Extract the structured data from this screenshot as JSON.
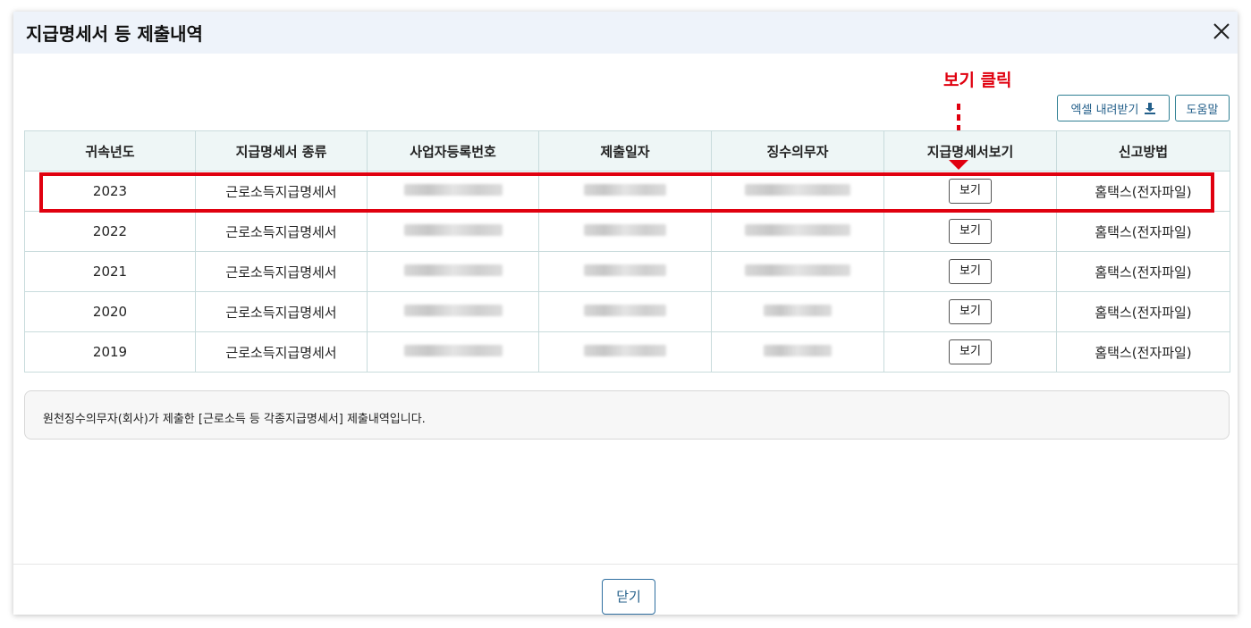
{
  "modal": {
    "title": "지급명세서 등 제출내역",
    "close_icon": "close-icon"
  },
  "annotation": {
    "text": "보기 클릭",
    "color": "#e0000f"
  },
  "toolbar": {
    "excel_label": "엑셀 내려받기",
    "excel_icon": "download-icon",
    "help_label": "도움말"
  },
  "table": {
    "headers": [
      "귀속년도",
      "지급명세서 종류",
      "사업자등록번호",
      "제출일자",
      "징수의무자",
      "지급명세서보기",
      "신고방법"
    ],
    "rows": [
      {
        "year": "2023",
        "type": "근로소득지급명세서",
        "view": "보기",
        "method": "홈택스(전자파일)"
      },
      {
        "year": "2022",
        "type": "근로소득지급명세서",
        "view": "보기",
        "method": "홈택스(전자파일)"
      },
      {
        "year": "2021",
        "type": "근로소득지급명세서",
        "view": "보기",
        "method": "홈택스(전자파일)"
      },
      {
        "year": "2020",
        "type": "근로소득지급명세서",
        "view": "보기",
        "method": "홈택스(전자파일)"
      },
      {
        "year": "2019",
        "type": "근로소득지급명세서",
        "view": "보기",
        "method": "홈택스(전자파일)"
      }
    ]
  },
  "notice": {
    "text": "원천징수의무자(회사)가 제출한 [근로소득 등 각종지급명세서] 제출내역입니다."
  },
  "footer": {
    "close_label": "닫기"
  }
}
